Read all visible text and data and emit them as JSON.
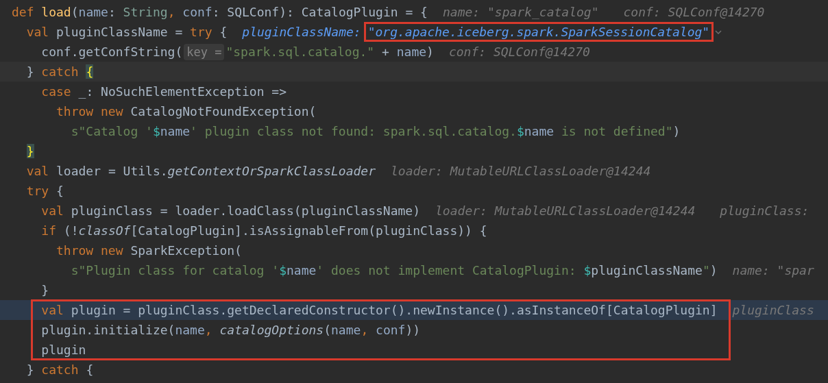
{
  "editor": {
    "lines": [
      {
        "current": false,
        "paused": false,
        "boxed": false,
        "tokens": [
          {
            "text": "def",
            "kind": "keyword"
          },
          {
            "text": " load",
            "kind": "function"
          },
          {
            "text": "(",
            "kind": "plain"
          },
          {
            "text": "name",
            "kind": "param"
          },
          {
            "text": ": ",
            "kind": "plain"
          },
          {
            "text": "String",
            "kind": "type"
          },
          {
            "text": ", ",
            "kind": "keyword"
          },
          {
            "text": "conf",
            "kind": "param"
          },
          {
            "text": ": SQLConf): CatalogPlugin = {",
            "kind": "plain"
          }
        ],
        "hints": [
          {
            "label": "name:",
            "value": "\"spark_catalog\"",
            "kind": "inline",
            "boxed": false,
            "expandable": false
          },
          {
            "label": "conf:",
            "value": "SQLConf@14270",
            "kind": "inline",
            "boxed": false,
            "expandable": false
          }
        ],
        "children": [
          {
            "current": false,
            "paused": false,
            "boxed": false,
            "tokens": [
              {
                "text": "val",
                "kind": "keyword"
              },
              {
                "text": " pluginClassName = ",
                "kind": "plain"
              },
              {
                "text": "try",
                "kind": "keyword"
              },
              {
                "text": " {",
                "kind": "plain"
              }
            ],
            "hints": [
              {
                "label": "pluginClassName:",
                "value": "\"org.apache.iceberg.spark.SparkSessionCatalog\"",
                "kind": "evaluated",
                "boxed": true,
                "expandable": true
              }
            ],
            "children": [
              {
                "current": false,
                "paused": false,
                "boxed": false,
                "tokens": [
                  {
                    "text": "conf.getConfString(",
                    "kind": "plain"
                  },
                  {
                    "text": "key =",
                    "kind": "chip"
                  },
                  {
                    "text": "\"spark.sql.catalog.\"",
                    "kind": "string"
                  },
                  {
                    "text": " + ",
                    "kind": "plain"
                  },
                  {
                    "text": "name",
                    "kind": "param"
                  },
                  {
                    "text": ")",
                    "kind": "plain"
                  }
                ],
                "hints": [
                  {
                    "label": "conf:",
                    "value": "SQLConf@14270",
                    "kind": "inline",
                    "boxed": false,
                    "expandable": false
                  }
                ]
              }
            ]
          },
          {
            "current": true,
            "paused": false,
            "boxed": false,
            "tokens": [
              {
                "text": "} ",
                "kind": "plain"
              },
              {
                "text": "catch ",
                "kind": "keyword"
              },
              {
                "text": "{",
                "kind": "brace-match"
              }
            ],
            "children": [
              {
                "current": false,
                "paused": false,
                "boxed": false,
                "tokens": [
                  {
                    "text": "case",
                    "kind": "keyword"
                  },
                  {
                    "text": " _: NoSuchElementException =>",
                    "kind": "plain"
                  }
                ],
                "children": [
                  {
                    "current": false,
                    "paused": false,
                    "boxed": false,
                    "tokens": [
                      {
                        "text": "throw new",
                        "kind": "keyword"
                      },
                      {
                        "text": " CatalogNotFoundException(",
                        "kind": "plain"
                      }
                    ],
                    "children": [
                      {
                        "current": false,
                        "paused": false,
                        "boxed": false,
                        "tokens": [
                          {
                            "text": "s\"Catalog '",
                            "kind": "string"
                          },
                          {
                            "text": "$",
                            "kind": "interp"
                          },
                          {
                            "text": "name",
                            "kind": "param"
                          },
                          {
                            "text": "' plugin class not found: spark.sql.catalog.",
                            "kind": "string"
                          },
                          {
                            "text": "$",
                            "kind": "interp"
                          },
                          {
                            "text": "name",
                            "kind": "param"
                          },
                          {
                            "text": " is not defined\"",
                            "kind": "string"
                          },
                          {
                            "text": ")",
                            "kind": "plain"
                          }
                        ]
                      }
                    ]
                  }
                ]
              }
            ]
          },
          {
            "current": false,
            "paused": false,
            "boxed": false,
            "tokens": [
              {
                "text": "}",
                "kind": "brace-match"
              }
            ]
          },
          {
            "current": false,
            "paused": false,
            "boxed": false,
            "tokens": [
              {
                "text": "val",
                "kind": "keyword"
              },
              {
                "text": " loader = Utils.",
                "kind": "plain"
              },
              {
                "text": "getContextOrSparkClassLoader",
                "kind": "italic"
              }
            ],
            "hints": [
              {
                "label": "loader:",
                "value": "MutableURLClassLoader@14244",
                "kind": "inline",
                "boxed": false,
                "expandable": false
              }
            ]
          },
          {
            "current": false,
            "paused": false,
            "boxed": false,
            "tokens": [
              {
                "text": "try",
                "kind": "keyword"
              },
              {
                "text": " {",
                "kind": "plain"
              }
            ],
            "children": [
              {
                "current": false,
                "paused": false,
                "boxed": false,
                "tokens": [
                  {
                    "text": "val",
                    "kind": "keyword"
                  },
                  {
                    "text": " pluginClass = loader.loadClass(pluginClassName)",
                    "kind": "plain"
                  }
                ],
                "hints": [
                  {
                    "label": "loader:",
                    "value": "MutableURLClassLoader@14244",
                    "kind": "inline",
                    "boxed": false,
                    "expandable": false
                  },
                  {
                    "label": "pluginClass:",
                    "kind": "inline",
                    "boxed": false,
                    "expandable": false
                  }
                ]
              },
              {
                "current": false,
                "paused": false,
                "boxed": false,
                "tokens": [
                  {
                    "text": "if",
                    "kind": "keyword"
                  },
                  {
                    "text": " (!",
                    "kind": "plain"
                  },
                  {
                    "text": "classOf",
                    "kind": "italic"
                  },
                  {
                    "text": "[CatalogPlugin].isAssignableFrom(pluginClass)) {",
                    "kind": "plain"
                  }
                ],
                "children": [
                  {
                    "current": false,
                    "paused": false,
                    "boxed": false,
                    "tokens": [
                      {
                        "text": "throw new",
                        "kind": "keyword"
                      },
                      {
                        "text": " SparkException(",
                        "kind": "plain"
                      }
                    ],
                    "children": [
                      {
                        "current": false,
                        "paused": false,
                        "boxed": false,
                        "tokens": [
                          {
                            "text": "s\"Plugin class for catalog '",
                            "kind": "string"
                          },
                          {
                            "text": "$",
                            "kind": "interp"
                          },
                          {
                            "text": "name",
                            "kind": "param"
                          },
                          {
                            "text": "' does not implement CatalogPlugin: ",
                            "kind": "string"
                          },
                          {
                            "text": "$",
                            "kind": "interp"
                          },
                          {
                            "text": "pluginClassName",
                            "kind": "plain"
                          },
                          {
                            "text": "\"",
                            "kind": "string"
                          },
                          {
                            "text": ")",
                            "kind": "plain"
                          }
                        ],
                        "hints": [
                          {
                            "label": "name:",
                            "value": "\"spar",
                            "kind": "inline",
                            "boxed": false,
                            "expandable": false
                          }
                        ]
                      }
                    ]
                  }
                ]
              },
              {
                "current": false,
                "paused": false,
                "boxed": false,
                "tokens": [
                  {
                    "text": "}",
                    "kind": "plain"
                  }
                ]
              },
              {
                "current": false,
                "paused": true,
                "boxed": true,
                "tokens": [
                  {
                    "text": "val",
                    "kind": "keyword"
                  },
                  {
                    "text": " plugin = pluginClass.getDeclaredConstructor().newInstance().asInstanceOf[CatalogPlugin]",
                    "kind": "plain"
                  }
                ],
                "hints": [
                  {
                    "label": "pluginClass",
                    "kind": "inline",
                    "boxed": false,
                    "expandable": false
                  }
                ]
              },
              {
                "current": false,
                "paused": false,
                "boxed": true,
                "tokens": [
                  {
                    "text": "plugin.initialize(",
                    "kind": "plain"
                  },
                  {
                    "text": "name",
                    "kind": "param"
                  },
                  {
                    "text": ", ",
                    "kind": "keyword"
                  },
                  {
                    "text": "catalogOptions",
                    "kind": "italic"
                  },
                  {
                    "text": "(",
                    "kind": "plain"
                  },
                  {
                    "text": "name",
                    "kind": "param"
                  },
                  {
                    "text": ", ",
                    "kind": "keyword"
                  },
                  {
                    "text": "conf",
                    "kind": "param"
                  },
                  {
                    "text": "))",
                    "kind": "plain"
                  }
                ]
              },
              {
                "current": false,
                "paused": false,
                "boxed": true,
                "tokens": [
                  {
                    "text": "plugin",
                    "kind": "plain"
                  }
                ]
              }
            ]
          },
          {
            "current": false,
            "paused": false,
            "boxed": false,
            "tokens": [
              {
                "text": "} ",
                "kind": "plain"
              },
              {
                "text": "catch",
                "kind": "keyword"
              },
              {
                "text": " {",
                "kind": "plain"
              }
            ]
          }
        ]
      }
    ]
  }
}
